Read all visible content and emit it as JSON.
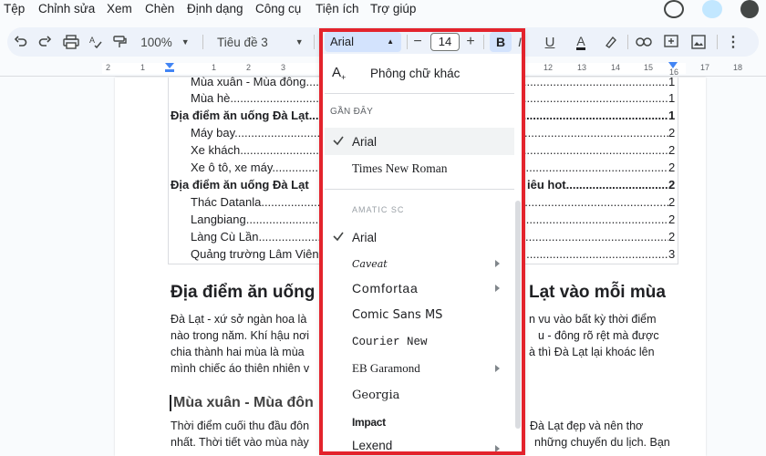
{
  "menu": {
    "items": [
      "Tệp",
      "Chỉnh sửa",
      "Xem",
      "Chèn",
      "Định dạng",
      "Công cụ",
      "Tiện ích",
      "Trợ giúp"
    ]
  },
  "toolbar": {
    "zoom": "100%",
    "style": "Tiêu đề 3",
    "font": "Arial",
    "font_size": "14",
    "minus": "−",
    "plus": "+",
    "bold": "B",
    "italic": "I",
    "underline": "U",
    "text_color": "A"
  },
  "ruler": {
    "numbers": [
      "2",
      "1",
      "1",
      "2",
      "3",
      "12",
      "13",
      "14",
      "15",
      "16",
      "17",
      "18"
    ]
  },
  "document": {
    "toc": [
      {
        "text": "Mùa xuân - Mùa đông",
        "page": "1",
        "bold": false,
        "indent": true
      },
      {
        "text": "Mùa hè",
        "page": "1",
        "bold": false,
        "indent": true
      },
      {
        "text": "Địa điểm ăn uống Đà Lạt",
        "page": "1",
        "bold": true,
        "indent": false
      },
      {
        "text": "Máy bay",
        "page": "2",
        "bold": false,
        "indent": true
      },
      {
        "text": "Xe khách",
        "page": "2",
        "bold": false,
        "indent": true
      },
      {
        "text": "Xe ô tô, xe máy",
        "page": "2",
        "bold": false,
        "indent": true
      },
      {
        "text": "Địa điểm ăn uống Đà Lạt",
        "tail": "iêu hot",
        "page": "2",
        "bold": true,
        "indent": false
      },
      {
        "text": "Thác Datanla",
        "page": "2",
        "bold": false,
        "indent": true
      },
      {
        "text": "Langbiang",
        "page": "2",
        "bold": false,
        "indent": true
      },
      {
        "text": "Làng Cù Lần",
        "page": "2",
        "bold": false,
        "indent": true
      },
      {
        "text": "Quảng trường Lâm Viên",
        "page": "3",
        "bold": false,
        "indent": true
      }
    ],
    "heading_left": "Địa điểm ăn uống",
    "heading_right": "Lạt vào mỗi mùa",
    "para1": [
      {
        "left": "Đà Lạt - xứ sở ngàn hoa là",
        "right": "n vu vào bất kỳ thời điểm"
      },
      {
        "left": "nào trong năm. Khí hậu nơi",
        "right": "u - đông rõ rệt mà được"
      },
      {
        "left": "chia thành hai mùa là mùa",
        "right": "à thì Đà Lạt lại khoác lên"
      },
      {
        "left": "mình chiếc áo thiên nhiên v",
        "right": ""
      }
    ],
    "subheading": "Mùa xuân - Mùa đôn",
    "para2": [
      {
        "left": "Thời điểm cuối thu đầu đôn",
        "right": "Đà Lạt đẹp và nên thơ"
      },
      {
        "left": "nhất. Thời tiết vào mùa này",
        "right": "những chuyến du lịch. Bạn"
      }
    ]
  },
  "font_menu": {
    "more_fonts": "Phông chữ khác",
    "recent_label": "GẦN ĐÂY",
    "recent": [
      {
        "name": "Arial",
        "checked": true
      },
      {
        "name": "Times New Roman",
        "checked": false
      }
    ],
    "fonts": [
      {
        "name": "Amatic SC",
        "checked": false,
        "submenu": false
      },
      {
        "name": "Arial",
        "checked": true,
        "submenu": false
      },
      {
        "name": "Caveat",
        "checked": false,
        "submenu": true
      },
      {
        "name": "Comfortaa",
        "checked": false,
        "submenu": true
      },
      {
        "name": "Comic Sans MS",
        "checked": false,
        "submenu": false
      },
      {
        "name": "Courier New",
        "checked": false,
        "submenu": false
      },
      {
        "name": "EB Garamond",
        "checked": false,
        "submenu": true
      },
      {
        "name": "Georgia",
        "checked": false,
        "submenu": false
      },
      {
        "name": "Impact",
        "checked": false,
        "submenu": false
      },
      {
        "name": "Lexend",
        "checked": false,
        "submenu": true
      }
    ]
  },
  "colors": {
    "highlight_border": "#e3232c",
    "selected_bg": "#d3e3fd",
    "toolbar_bg": "#edf2fa"
  }
}
